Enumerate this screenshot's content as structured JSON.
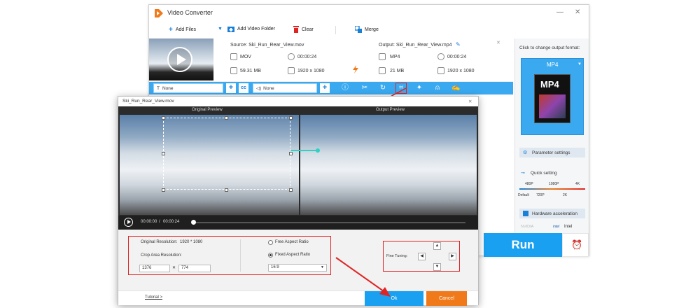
{
  "app": {
    "title": "Video Converter",
    "minimize": "—",
    "close": "✕"
  },
  "toolbar": {
    "add_files": "Add Files",
    "add_video_folder": "Add Video Folder",
    "clear": "Clear",
    "merge": "Merge"
  },
  "source": {
    "label": "Source: Ski_Run_Rear_View.mov",
    "format": "MOV",
    "duration": "00:00:24",
    "size": "59.31 MB",
    "resolution": "1920 x 1080"
  },
  "output": {
    "label": "Output: Ski_Run_Rear_View.mp4",
    "format": "MP4",
    "duration": "00:00:24",
    "size": "21 MB",
    "resolution": "1920 x 1080"
  },
  "edit_bar": {
    "subtitle": "None",
    "audio": "None"
  },
  "right_panel": {
    "hint": "Click to change output format:",
    "format": "MP4",
    "format_badge": "MP4",
    "param_settings": "Parameter settings",
    "quick_setting": "Quick setting",
    "quality_top": [
      "480P",
      "1080P",
      "4K"
    ],
    "quality_bottom": [
      "Default",
      "720P",
      "2K"
    ],
    "hw_accel": "Hardware acceleration",
    "gpu_nvidia": "NVIDIA",
    "gpu_intel": "Intel",
    "run": "Run"
  },
  "dialog": {
    "title": "Ski_Run_Rear_View.mov",
    "close": "✕",
    "original_preview": "Original Preview",
    "output_preview": "Output Preview",
    "time_current": "00:00:00",
    "time_sep": "/",
    "time_total": "00:00:24",
    "orig_res_label": "Original Resolution:",
    "orig_res_value": "1920 * 1080",
    "crop_res_label": "Crop Area Resolution:",
    "crop_w": "1376",
    "crop_x": "✕",
    "crop_h": "774",
    "free_aspect": "Free Aspect Ratio",
    "fixed_aspect": "Fixed Aspect Ratio",
    "aspect_value": "16:9",
    "fine_tuning": "Fine Tuning:",
    "tutorial": "Tutorial >",
    "ok": "Ok",
    "cancel": "Cancel"
  },
  "colors": {
    "accent": "#1aa0f0",
    "cancel": "#f07a1a",
    "highlight": "#e02424"
  }
}
